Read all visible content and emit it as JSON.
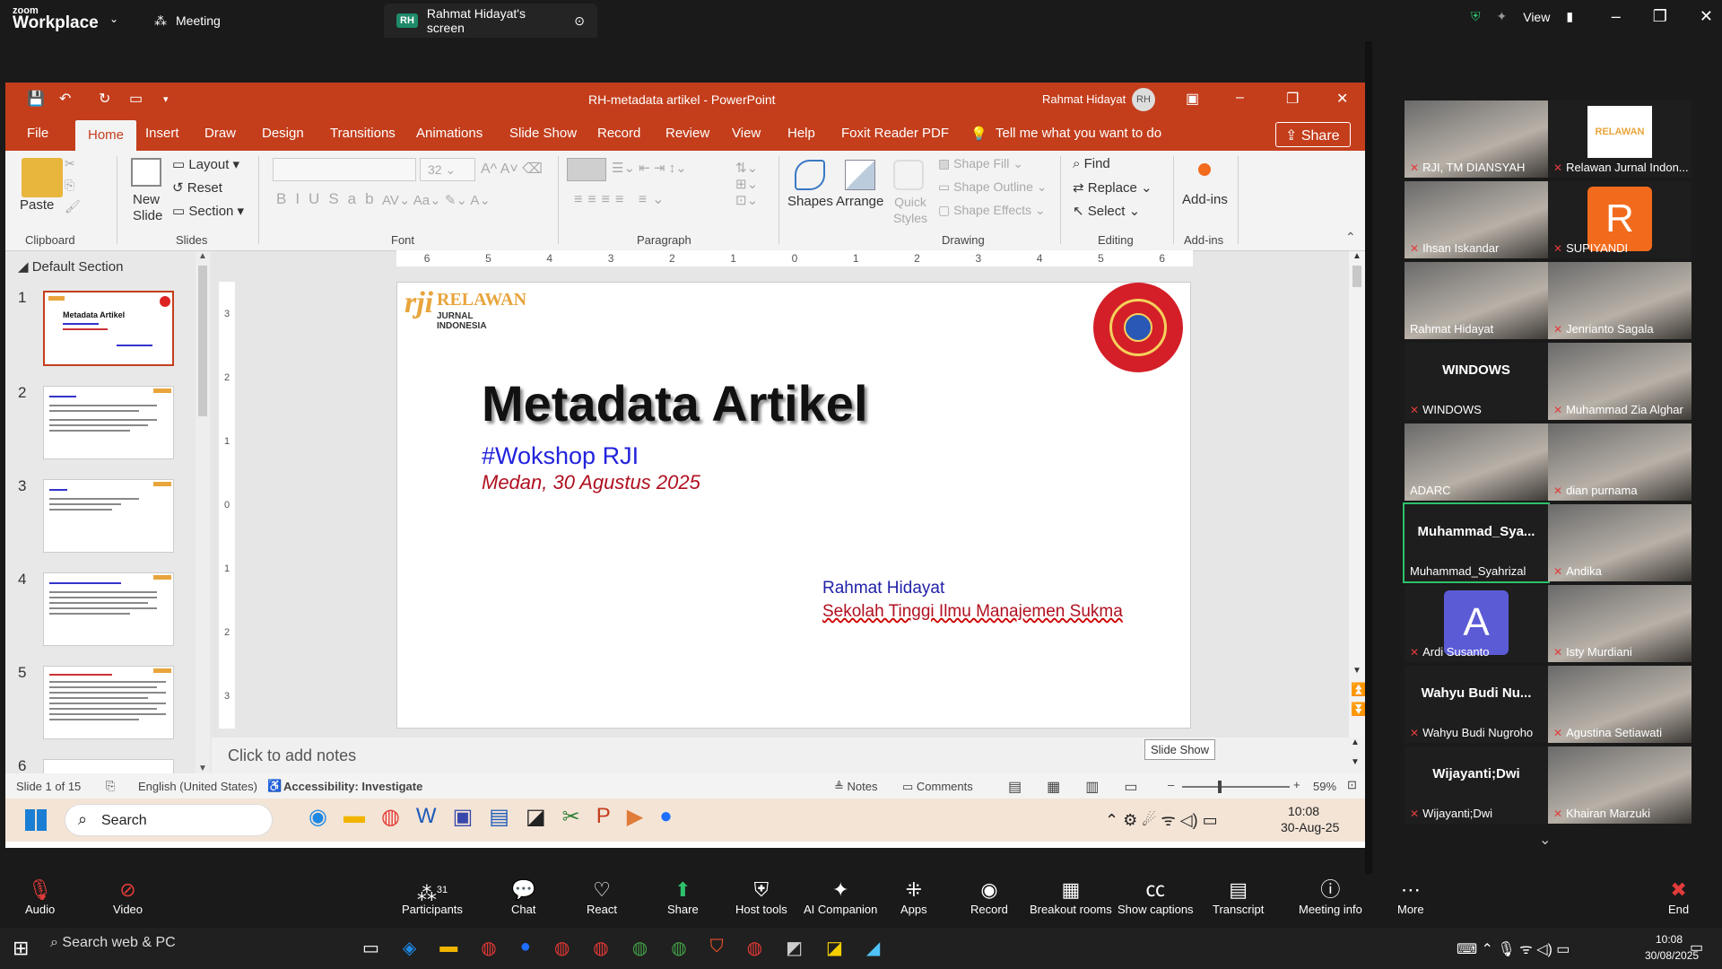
{
  "zoom": {
    "brand_small": "zoom",
    "brand_big": "Workplace",
    "tab_meeting": "Meeting",
    "tab_screen": "Rahmat Hidayat's screen",
    "tab_badge": "RH",
    "view_label": "View"
  },
  "ppt": {
    "title": "RH-metadata artikel - PowerPoint",
    "user": "Rahmat Hidayat",
    "user_initials": "RH",
    "tabs": [
      "File",
      "Home",
      "Insert",
      "Draw",
      "Design",
      "Transitions",
      "Animations",
      "Slide Show",
      "Record",
      "Review",
      "View",
      "Help",
      "Foxit Reader PDF"
    ],
    "tell_me": "Tell me what you want to do",
    "share": "Share",
    "ribbon": {
      "paste": "Paste",
      "clipboard": "Clipboard",
      "new_slide": "New Slide",
      "layout": "Layout",
      "reset": "Reset",
      "section": "Section",
      "slides": "Slides",
      "font_size": "32",
      "font": "Font",
      "paragraph": "Paragraph",
      "shapes": "Shapes",
      "arrange": "Arrange",
      "quick_styles": "Quick Styles",
      "shape_fill": "Shape Fill",
      "shape_outline": "Shape Outline",
      "shape_effects": "Shape Effects",
      "drawing": "Drawing",
      "find": "Find",
      "replace": "Replace",
      "select": "Select",
      "editing": "Editing",
      "addins": "Add-ins",
      "addins_group": "Add-ins"
    },
    "section_name": "Default Section",
    "thumb_nums": [
      "1",
      "2",
      "3",
      "4",
      "5",
      "6"
    ],
    "ruler_labels": [
      "6",
      "5",
      "4",
      "3",
      "2",
      "1",
      "0",
      "1",
      "2",
      "3",
      "4",
      "5",
      "6"
    ],
    "vruler_labels": [
      "3",
      "2",
      "1",
      "0",
      "1",
      "2",
      "3"
    ],
    "slide": {
      "logo_text_top": "RELAWAN",
      "logo_text_bottom": "JURNAL INDONESIA",
      "title": "Metadata Artikel",
      "subtitle": "#Wokshop RJI",
      "date": "Medan, 30 Agustus 2025",
      "author": "Rahmat Hidayat",
      "institution": "Sekolah Tinggi Ilmu Manajemen Sukma"
    },
    "notes_placeholder": "Click to add notes",
    "tooltip": "Slide Show",
    "status": {
      "slide": "Slide 1 of 15",
      "lang": "English (United States)",
      "access": "Accessibility: Investigate",
      "notes": "Notes",
      "comments": "Comments",
      "zoom": "59%"
    },
    "inner_taskbar": {
      "search": "Search",
      "time": "10:08",
      "date": "30-Aug-25"
    }
  },
  "participants_gallery": [
    {
      "name": "RJI, TM DIANSYAH",
      "muted": true,
      "kind": "video"
    },
    {
      "name": "Relawan Jurnal Indon...",
      "muted": true,
      "kind": "logo",
      "logo": "RELAWAN"
    },
    {
      "name": "Ihsan Iskandar",
      "muted": true,
      "kind": "video"
    },
    {
      "name": "SUPIYANDI",
      "muted": true,
      "kind": "avatar",
      "letter": "R",
      "color": "#f26b1d"
    },
    {
      "name": "Rahmat Hidayat",
      "muted": false,
      "kind": "video"
    },
    {
      "name": "Jenrianto Sagala",
      "muted": true,
      "kind": "video"
    },
    {
      "name": "WINDOWS",
      "muted": true,
      "kind": "text",
      "big": "WINDOWS"
    },
    {
      "name": "Muhammad Zia Alghar",
      "muted": true,
      "kind": "video"
    },
    {
      "name": "ADARC",
      "muted": false,
      "kind": "video"
    },
    {
      "name": "dian purnama",
      "muted": true,
      "kind": "video"
    },
    {
      "name": "Muhammad_Syahrizal",
      "muted": false,
      "kind": "text",
      "big": "Muhammad_Sya...",
      "active": true
    },
    {
      "name": "Andika",
      "muted": true,
      "kind": "video"
    },
    {
      "name": "Ardi Susanto",
      "muted": true,
      "kind": "avatar",
      "letter": "A",
      "color": "#5b5bd6"
    },
    {
      "name": "Isty Murdiani",
      "muted": true,
      "kind": "video"
    },
    {
      "name": "Wahyu Budi Nugroho",
      "muted": true,
      "kind": "text",
      "big": "Wahyu Budi Nu..."
    },
    {
      "name": "Agustina Setiawati",
      "muted": true,
      "kind": "video"
    },
    {
      "name": "Wijayanti;Dwi",
      "muted": true,
      "kind": "text",
      "big": "Wijayanti;Dwi"
    },
    {
      "name": "Khairan Marzuki",
      "muted": true,
      "kind": "video"
    }
  ],
  "toolbar": {
    "audio": "Audio",
    "video": "Video",
    "participants": "Participants",
    "participants_count": "31",
    "chat": "Chat",
    "react": "React",
    "share": "Share",
    "host_tools": "Host tools",
    "ai": "AI Companion",
    "apps": "Apps",
    "record": "Record",
    "breakout": "Breakout rooms",
    "captions": "Show captions",
    "transcript": "Transcript",
    "meeting_info": "Meeting info",
    "more": "More",
    "end": "End"
  },
  "win": {
    "search": "Search web & PC",
    "time": "10:08",
    "date": "30/08/2025"
  }
}
